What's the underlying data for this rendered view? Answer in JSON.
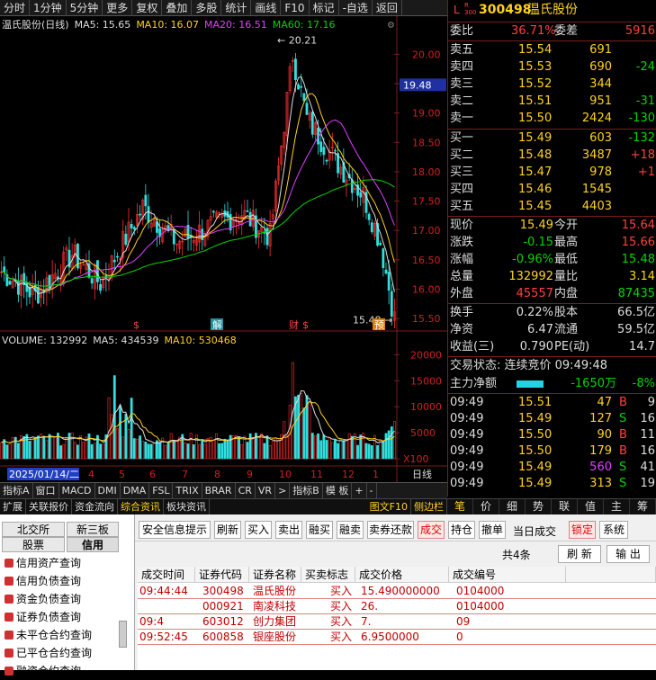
{
  "toolbar": [
    "分时",
    "1分钟",
    "5分钟",
    "更多",
    "复权",
    "叠加",
    "多股",
    "统计",
    "画线",
    "F10",
    "标记",
    "-自选",
    "返回"
  ],
  "ma_line": {
    "title": "温氏股份(日线)",
    "ma5": "MA5: 15.65",
    "ma10": "MA10: 16.07",
    "ma20": "MA20: 16.51",
    "ma60": "MA60: 17.16"
  },
  "price_axis": [
    "20.00",
    "19.50",
    "19.00",
    "18.50",
    "18.00",
    "17.50",
    "17.00",
    "16.50",
    "16.00",
    "15.50"
  ],
  "current_price_tag": "19.48",
  "high_label": "20.21",
  "low_label": "15.48",
  "event_markers": [
    "$",
    "解",
    "财",
    "$",
    "预"
  ],
  "vol_line": {
    "vol": "VOLUME: 132992",
    "ma5": "MA5: 434539",
    "ma10": "MA10: 530468"
  },
  "vol_axis": [
    "20000",
    "15000",
    "10000",
    "5000",
    "X100"
  ],
  "date_label": "2025/01/14/二",
  "month_ticks": [
    "4",
    "5",
    "6",
    "7",
    "8",
    "9",
    "10",
    "11",
    "12",
    "1"
  ],
  "period_label": "日线",
  "indicator_tabs": [
    "指标A",
    "窗口",
    "MACD",
    "DMI",
    "DMA",
    "FSL",
    "TRIX",
    "BRAR",
    "CR",
    "VR",
    ">",
    "指标B",
    "模 板",
    "+",
    "-"
  ],
  "info_tabs": [
    "扩展",
    "关联报价",
    "资金流向",
    "综合资讯",
    "板块资讯"
  ],
  "info_tabs_right": [
    "图文F10",
    "侧边栏"
  ],
  "right_tabs": [
    "笔",
    "价",
    "细",
    "势",
    "联",
    "值",
    "主",
    "筹"
  ],
  "stock": {
    "prefix": "L",
    "market": "R\n300",
    "code": "300498",
    "name": "温氏股份"
  },
  "weibi": {
    "label1": "委比",
    "v1": "36.71%",
    "label2": "委差",
    "v2": "5916"
  },
  "asks": [
    {
      "l": "卖五",
      "p": "15.54",
      "v": "691",
      "c": ""
    },
    {
      "l": "卖四",
      "p": "15.53",
      "v": "690",
      "c": "-24"
    },
    {
      "l": "卖三",
      "p": "15.52",
      "v": "344",
      "c": ""
    },
    {
      "l": "卖二",
      "p": "15.51",
      "v": "951",
      "c": "-31"
    },
    {
      "l": "卖一",
      "p": "15.50",
      "v": "2424",
      "c": "-130"
    }
  ],
  "bids": [
    {
      "l": "买一",
      "p": "15.49",
      "v": "603",
      "c": "-132"
    },
    {
      "l": "买二",
      "p": "15.48",
      "v": "3487",
      "c": "+18"
    },
    {
      "l": "买三",
      "p": "15.47",
      "v": "978",
      "c": "+1"
    },
    {
      "l": "买四",
      "p": "15.46",
      "v": "1545",
      "c": ""
    },
    {
      "l": "买五",
      "p": "15.45",
      "v": "4403",
      "c": ""
    }
  ],
  "stats": [
    {
      "l1": "现价",
      "v1": "15.49",
      "l2": "今开",
      "v2": "15.64"
    },
    {
      "l1": "涨跌",
      "v1": "-0.15",
      "l2": "最高",
      "v2": "15.66"
    },
    {
      "l1": "涨幅",
      "v1": "-0.96%",
      "l2": "最低",
      "v2": "15.48"
    },
    {
      "l1": "总量",
      "v1": "132992",
      "l2": "量比",
      "v2": "3.14"
    },
    {
      "l1": "外盘",
      "v1": "45557",
      "l2": "内盘",
      "v2": "87435"
    }
  ],
  "stats2": [
    {
      "l1": "换手",
      "v1": "0.22%",
      "l2": "股本",
      "v2": "66.5亿"
    },
    {
      "l1": "净资",
      "v1": "6.47",
      "l2": "流通",
      "v2": "59.5亿"
    },
    {
      "l1": "收益(三)",
      "v1": "0.790",
      "l2": "PE(动)",
      "v2": "14.7"
    }
  ],
  "trade_status": "交易状态: 连续竞价 09:49:48",
  "main_flow": {
    "label": "主力净额",
    "v": "-1650万",
    "pct": "-8%"
  },
  "ticks": [
    {
      "t": "09:49",
      "p": "15.51",
      "v": "47",
      "bs": "B",
      "n": "9"
    },
    {
      "t": "09:49",
      "p": "15.49",
      "v": "127",
      "bs": "S",
      "n": "16"
    },
    {
      "t": "09:49",
      "p": "15.50",
      "v": "90",
      "bs": "B",
      "n": "11"
    },
    {
      "t": "09:49",
      "p": "15.50",
      "v": "179",
      "bs": "B",
      "n": "16"
    },
    {
      "t": "09:49",
      "p": "15.49",
      "v": "560",
      "bs": "S",
      "n": "41"
    },
    {
      "t": "09:49",
      "p": "15.49",
      "v": "313",
      "bs": "S",
      "n": "19"
    }
  ],
  "leftnav": {
    "tabs": [
      "北交所",
      "新三板",
      "股票",
      "信用"
    ],
    "items": [
      "信用资产查询",
      "信用负债查询",
      "资金负债查询",
      "证券负债查询",
      "未平仓合约查询",
      "已平仓合约查询",
      "融资合约查询"
    ]
  },
  "trade_buttons": [
    "安全信息提示",
    "刷新",
    "买入",
    "卖出",
    "融买",
    "融卖",
    "卖券还款",
    "成交",
    "持仓",
    "撤单",
    "当日成交",
    "锁定",
    "系统"
  ],
  "summary": "共4条",
  "refresh": "刷 新",
  "export": "输 出",
  "table_headers": [
    "成交时间",
    "证券代码",
    "证券名称",
    "买卖标志",
    "成交价格",
    "成交编号"
  ],
  "trades": [
    {
      "time": "09:44:44",
      "code": "300498",
      "name": "温氏股份",
      "side": "买入",
      "price": "15.490000000",
      "no": "0104000"
    },
    {
      "time": "",
      "code": "000921",
      "name": "南凌科技",
      "side": "买入",
      "price": "26.",
      "no": "0104000"
    },
    {
      "time": "09:4",
      "code": "603012",
      "name": "创力集团",
      "side": "买入",
      "price": "7.",
      "no": "09"
    },
    {
      "time": "09:52:45",
      "code": "600858",
      "name": "银座股份",
      "side": "买入",
      "price": "6.9500000",
      "no": "0"
    }
  ]
}
